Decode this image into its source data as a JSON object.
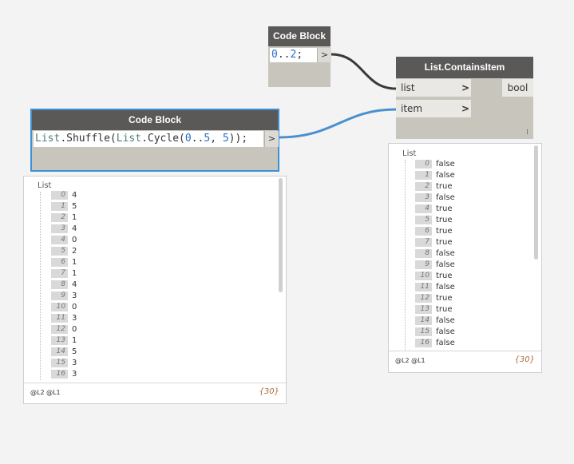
{
  "node1": {
    "title": "Code Block",
    "code": [
      {
        "t": "0",
        "c": "num"
      },
      {
        "t": "..",
        "c": ""
      },
      {
        "t": "2",
        "c": "num"
      },
      {
        "t": ";",
        "c": ""
      }
    ],
    "out_label": ">"
  },
  "node2": {
    "title": "Code Block",
    "code": [
      {
        "t": "List",
        "c": "fn"
      },
      {
        "t": ".Shuffle(",
        "c": ""
      },
      {
        "t": "List",
        "c": "fn"
      },
      {
        "t": ".Cycle(",
        "c": ""
      },
      {
        "t": "0",
        "c": "num"
      },
      {
        "t": "..",
        "c": ""
      },
      {
        "t": "5",
        "c": "num"
      },
      {
        "t": ", ",
        "c": ""
      },
      {
        "t": "5",
        "c": "num"
      },
      {
        "t": "));",
        "c": ""
      }
    ],
    "out_label": ">"
  },
  "node3": {
    "title": "List.ContainsItem",
    "inputs": [
      {
        "label": "list",
        "chevron": ">"
      },
      {
        "label": "item",
        "chevron": ">"
      }
    ],
    "output": "bool",
    "resize": "⁞"
  },
  "preview_left": {
    "header": "List",
    "rows": [
      {
        "i": "0",
        "v": "4"
      },
      {
        "i": "1",
        "v": "5"
      },
      {
        "i": "2",
        "v": "1"
      },
      {
        "i": "3",
        "v": "4"
      },
      {
        "i": "4",
        "v": "0"
      },
      {
        "i": "5",
        "v": "2"
      },
      {
        "i": "6",
        "v": "1"
      },
      {
        "i": "7",
        "v": "1"
      },
      {
        "i": "8",
        "v": "4"
      },
      {
        "i": "9",
        "v": "3"
      },
      {
        "i": "10",
        "v": "0"
      },
      {
        "i": "11",
        "v": "3"
      },
      {
        "i": "12",
        "v": "0"
      },
      {
        "i": "13",
        "v": "1"
      },
      {
        "i": "14",
        "v": "5"
      },
      {
        "i": "15",
        "v": "3"
      },
      {
        "i": "16",
        "v": "3"
      }
    ],
    "levels": "@L2 @L1",
    "count": "{30}"
  },
  "preview_right": {
    "header": "List",
    "rows": [
      {
        "i": "0",
        "v": "false"
      },
      {
        "i": "1",
        "v": "false"
      },
      {
        "i": "2",
        "v": "true"
      },
      {
        "i": "3",
        "v": "false"
      },
      {
        "i": "4",
        "v": "true"
      },
      {
        "i": "5",
        "v": "true"
      },
      {
        "i": "6",
        "v": "true"
      },
      {
        "i": "7",
        "v": "true"
      },
      {
        "i": "8",
        "v": "false"
      },
      {
        "i": "9",
        "v": "false"
      },
      {
        "i": "10",
        "v": "true"
      },
      {
        "i": "11",
        "v": "false"
      },
      {
        "i": "12",
        "v": "true"
      },
      {
        "i": "13",
        "v": "true"
      },
      {
        "i": "14",
        "v": "false"
      },
      {
        "i": "15",
        "v": "false"
      },
      {
        "i": "16",
        "v": "false"
      }
    ],
    "levels": "@L2 @L1",
    "count": "{30}"
  },
  "colors": {
    "wire_dark": "#3a3a3a",
    "wire_selected": "#4a90d0",
    "selection": "#3d8fd6"
  }
}
